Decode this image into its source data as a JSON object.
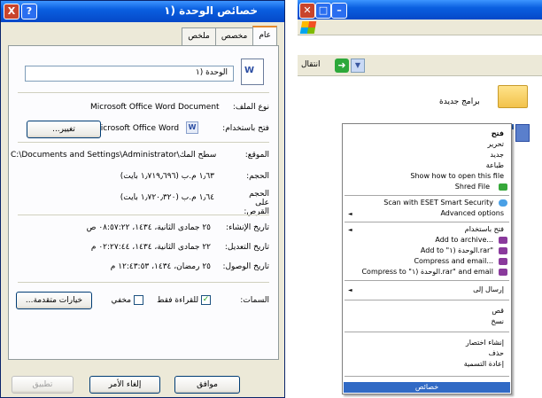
{
  "dialog": {
    "title": "خصائص الوحدة (١",
    "close": "X",
    "help": "?",
    "tabs": [
      "عام",
      "مخصص",
      "ملخص"
    ],
    "file_name": "الوحدة (١",
    "type_label": "نوع الملف:",
    "type_value": "Microsoft Office Word Document",
    "opens_label": "فتح باستخدام:",
    "opens_value": "Microsoft Office Word",
    "change_button": "تغيير...",
    "location_label": "الموقع:",
    "location_value": "C:\\Documents and Settings\\Administrator\\سطح المك",
    "size_label": "الحجم:",
    "size_value": "١٫٦٣ م.ب (١٫٧١٩٫٦٩٦ بايت)",
    "size_on_disk_label": "الحجم على القرص:",
    "size_on_disk_value": "١٫٦٤ م.ب (١٫٧٢٠٫٣٢٠ بايت)",
    "created_label": "تاريخ الإنشاء:",
    "created_value": "٢٥ جمادى الثانية، ١٤٣٤، ٠٨:٥٧:٢٢ ص",
    "modified_label": "تاريخ التعديل:",
    "modified_value": "٢٢ جمادى الثانية، ١٤٣٤، ٠٢:٢٧:٤٤ م",
    "accessed_label": "تاريخ الوصول:",
    "accessed_value": "٢٥ رمضان، ١٤٣٤، ١٢:٤٣:٥٣ م",
    "attributes_label": "السمات:",
    "readonly_label": "للقراءة فقط",
    "hidden_label": "مخفي",
    "advanced_button": "خيارات متقدمة...",
    "ok_button": "موافق",
    "cancel_button": "إلغاء الأمر",
    "apply_button": "تطبيق"
  },
  "explorer": {
    "go_label": "انتقال",
    "folder_label": "برامج جديدة",
    "dropdown_arrow": "▼",
    "go_arrow": "➜"
  },
  "context_menu": {
    "open": "فتح",
    "edit": "تحرير",
    "new": "جديد",
    "print": "طباعة",
    "show_how": "Show how to open this file",
    "shred": "Shred File",
    "eset": "Scan with ESET Smart Security",
    "advanced": "Advanced options",
    "open_with": "فتح باستخدام",
    "add_archive": "Add to archive...",
    "add_rar": "Add to \"الوحدة (١.rar\"",
    "compress_email": "Compress and email...",
    "compress_rar_email": "Compress to \"الوحدة (١.rar\" and email",
    "send_to": "إرسال إلى",
    "cut": "قص",
    "copy": "نسخ",
    "create_shortcut": "إنشاء اختصار",
    "delete": "حذف",
    "rename": "إعادة التسمية",
    "properties": "خصائص",
    "submenu_arrow": "◄"
  },
  "colors": {
    "titlebar": "#0a5fe0",
    "highlight": "#316ac5",
    "dialog_bg": "#ece9d8"
  }
}
